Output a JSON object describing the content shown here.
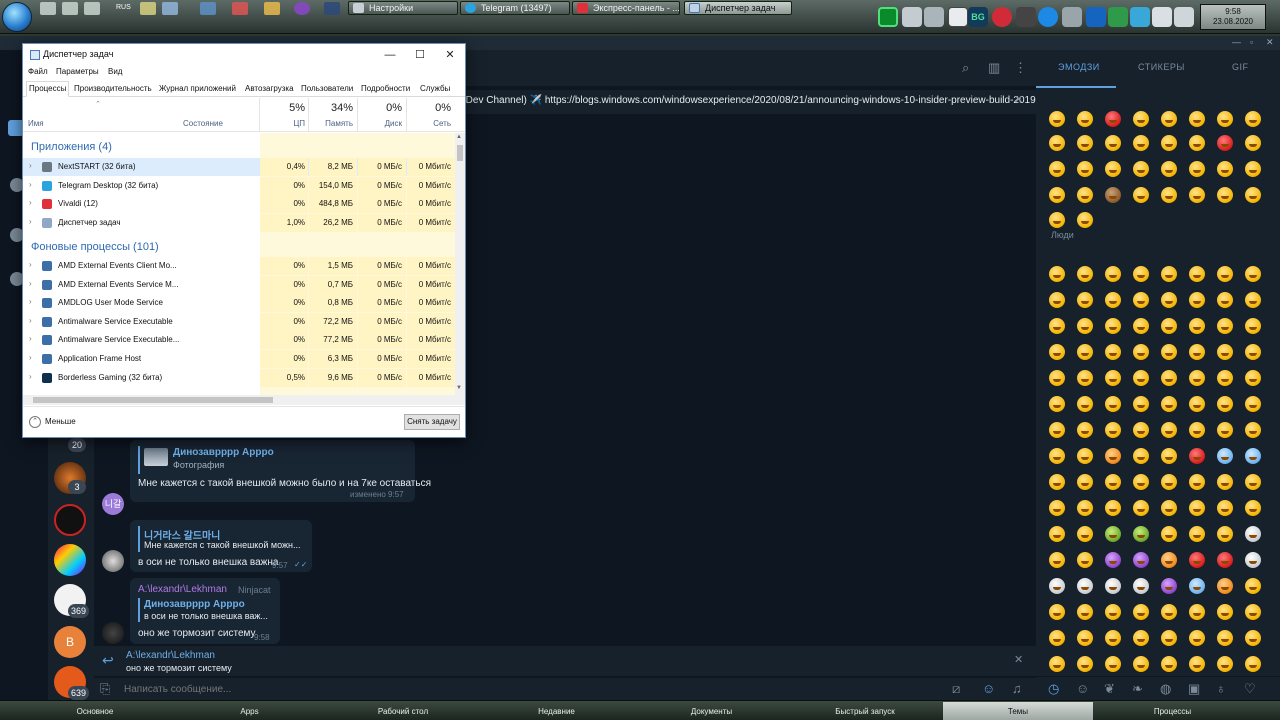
{
  "topbar": {
    "tasks": [
      {
        "label": "Настройки",
        "active": false
      },
      {
        "label": "Telegram (13497)",
        "active": false
      },
      {
        "label": "Экспресс-панель - ...",
        "active": false
      },
      {
        "label": "Диспетчер задач",
        "active": true
      }
    ],
    "quick_label": "RUS",
    "clock_time": "9:58",
    "clock_date": "23.08.2020",
    "tray_bg_label": "BG"
  },
  "task_manager": {
    "title": "Диспетчер задач",
    "menu": [
      "Файл",
      "Параметры",
      "Вид"
    ],
    "tabs": [
      "Процессы",
      "Производительность",
      "Журнал приложений",
      "Автозагрузка",
      "Пользователи",
      "Подробности",
      "Службы"
    ],
    "active_tab": "Процессы",
    "columns": {
      "name": "Имя",
      "status": "Состояние",
      "cpu_pct": "5%",
      "cpu": "ЦП",
      "mem_pct": "34%",
      "mem": "Память",
      "disk_pct": "0%",
      "disk": "Диск",
      "net_pct": "0%",
      "net": "Сеть"
    },
    "groups": {
      "apps_title": "Приложения (4)",
      "bg_title": "Фоновые процессы (101)"
    },
    "apps": [
      {
        "name": "NextSTART (32 бита)",
        "cpu": "0,4%",
        "mem": "8,2 МБ",
        "disk": "0 МБ/с",
        "net": "0 Мбит/с"
      },
      {
        "name": "Telegram Desktop (32 бита)",
        "cpu": "0%",
        "mem": "154,0 МБ",
        "disk": "0 МБ/с",
        "net": "0 Мбит/с"
      },
      {
        "name": "Vivaldi (12)",
        "cpu": "0%",
        "mem": "484,8 МБ",
        "disk": "0 МБ/с",
        "net": "0 Мбит/с"
      },
      {
        "name": "Диспетчер задач",
        "cpu": "1,0%",
        "mem": "26,2 МБ",
        "disk": "0 МБ/с",
        "net": "0 Мбит/с"
      }
    ],
    "background": [
      {
        "name": "AMD External Events Client Mo...",
        "cpu": "0%",
        "mem": "1,5 МБ",
        "disk": "0 МБ/с",
        "net": "0 Мбит/с"
      },
      {
        "name": "AMD External Events Service M...",
        "cpu": "0%",
        "mem": "0,7 МБ",
        "disk": "0 МБ/с",
        "net": "0 Мбит/с"
      },
      {
        "name": "AMDLOG User Mode Service",
        "cpu": "0%",
        "mem": "0,8 МБ",
        "disk": "0 МБ/с",
        "net": "0 Мбит/с"
      },
      {
        "name": "Antimalware Service Executable",
        "cpu": "0%",
        "mem": "72,2 МБ",
        "disk": "0 МБ/с",
        "net": "0 Мбит/с"
      },
      {
        "name": "Antimalware Service Executable...",
        "cpu": "0%",
        "mem": "77,2 МБ",
        "disk": "0 МБ/с",
        "net": "0 Мбит/с"
      },
      {
        "name": "Application Frame Host",
        "cpu": "0%",
        "mem": "6,3 МБ",
        "disk": "0 МБ/с",
        "net": "0 Мбит/с"
      },
      {
        "name": "Borderless Gaming (32 бита)",
        "cpu": "0,5%",
        "mem": "9,6 МБ",
        "disk": "0 МБ/с",
        "net": "0 Мбит/с"
      }
    ],
    "fewer_details": "Меньше",
    "end_task": "Снять задачу"
  },
  "telegram": {
    "pinned_text": "7 (Dev Channel) ✈️ https://blogs.windows.com/windowsexperience/2020/08/21/announcing-windows-10-insider-preview-build-2019...",
    "chat_badges": [
      "20",
      "3",
      "369",
      "639"
    ],
    "chat_letter": "B",
    "messages": [
      {
        "reply_name": "Динозаврррр Аррро",
        "reply_sub": "Фотография",
        "text": "Мне кажется с такой внешкой можно было и на 7ке оставаться",
        "time": "изменено 9:57",
        "avatar": "니갈"
      },
      {
        "reply_name": "니거라스 갈드마니",
        "reply_sub": "Мне кажется с такой внешкой можн...",
        "text": "в оси не только внешка важна",
        "time": "9:57"
      },
      {
        "author": "A:\\lexandr\\Lekhman",
        "author_tag": "Ninjacat",
        "reply_name": "Динозаврррр Аррро",
        "reply_sub": "в оси не только внешка важ...",
        "text": "оно же тормозит систему",
        "time": "9:58"
      }
    ],
    "reply_panel": {
      "name": "A:\\lexandr\\Lekhman",
      "text": "оно же тормозит систему"
    },
    "composer_placeholder": "Написать сообщение...",
    "emoji_tabs": [
      "ЭМОДЗИ",
      "СТИКЕРЫ",
      "GIF"
    ],
    "emoji_section_people": "Люди"
  },
  "bottombar": {
    "items": [
      "Основное",
      "Apps",
      "Рабочий стол",
      "Недавние",
      "Документы",
      "Быстрый запуск",
      "Темы",
      "Процессы"
    ],
    "active": "Темы"
  }
}
